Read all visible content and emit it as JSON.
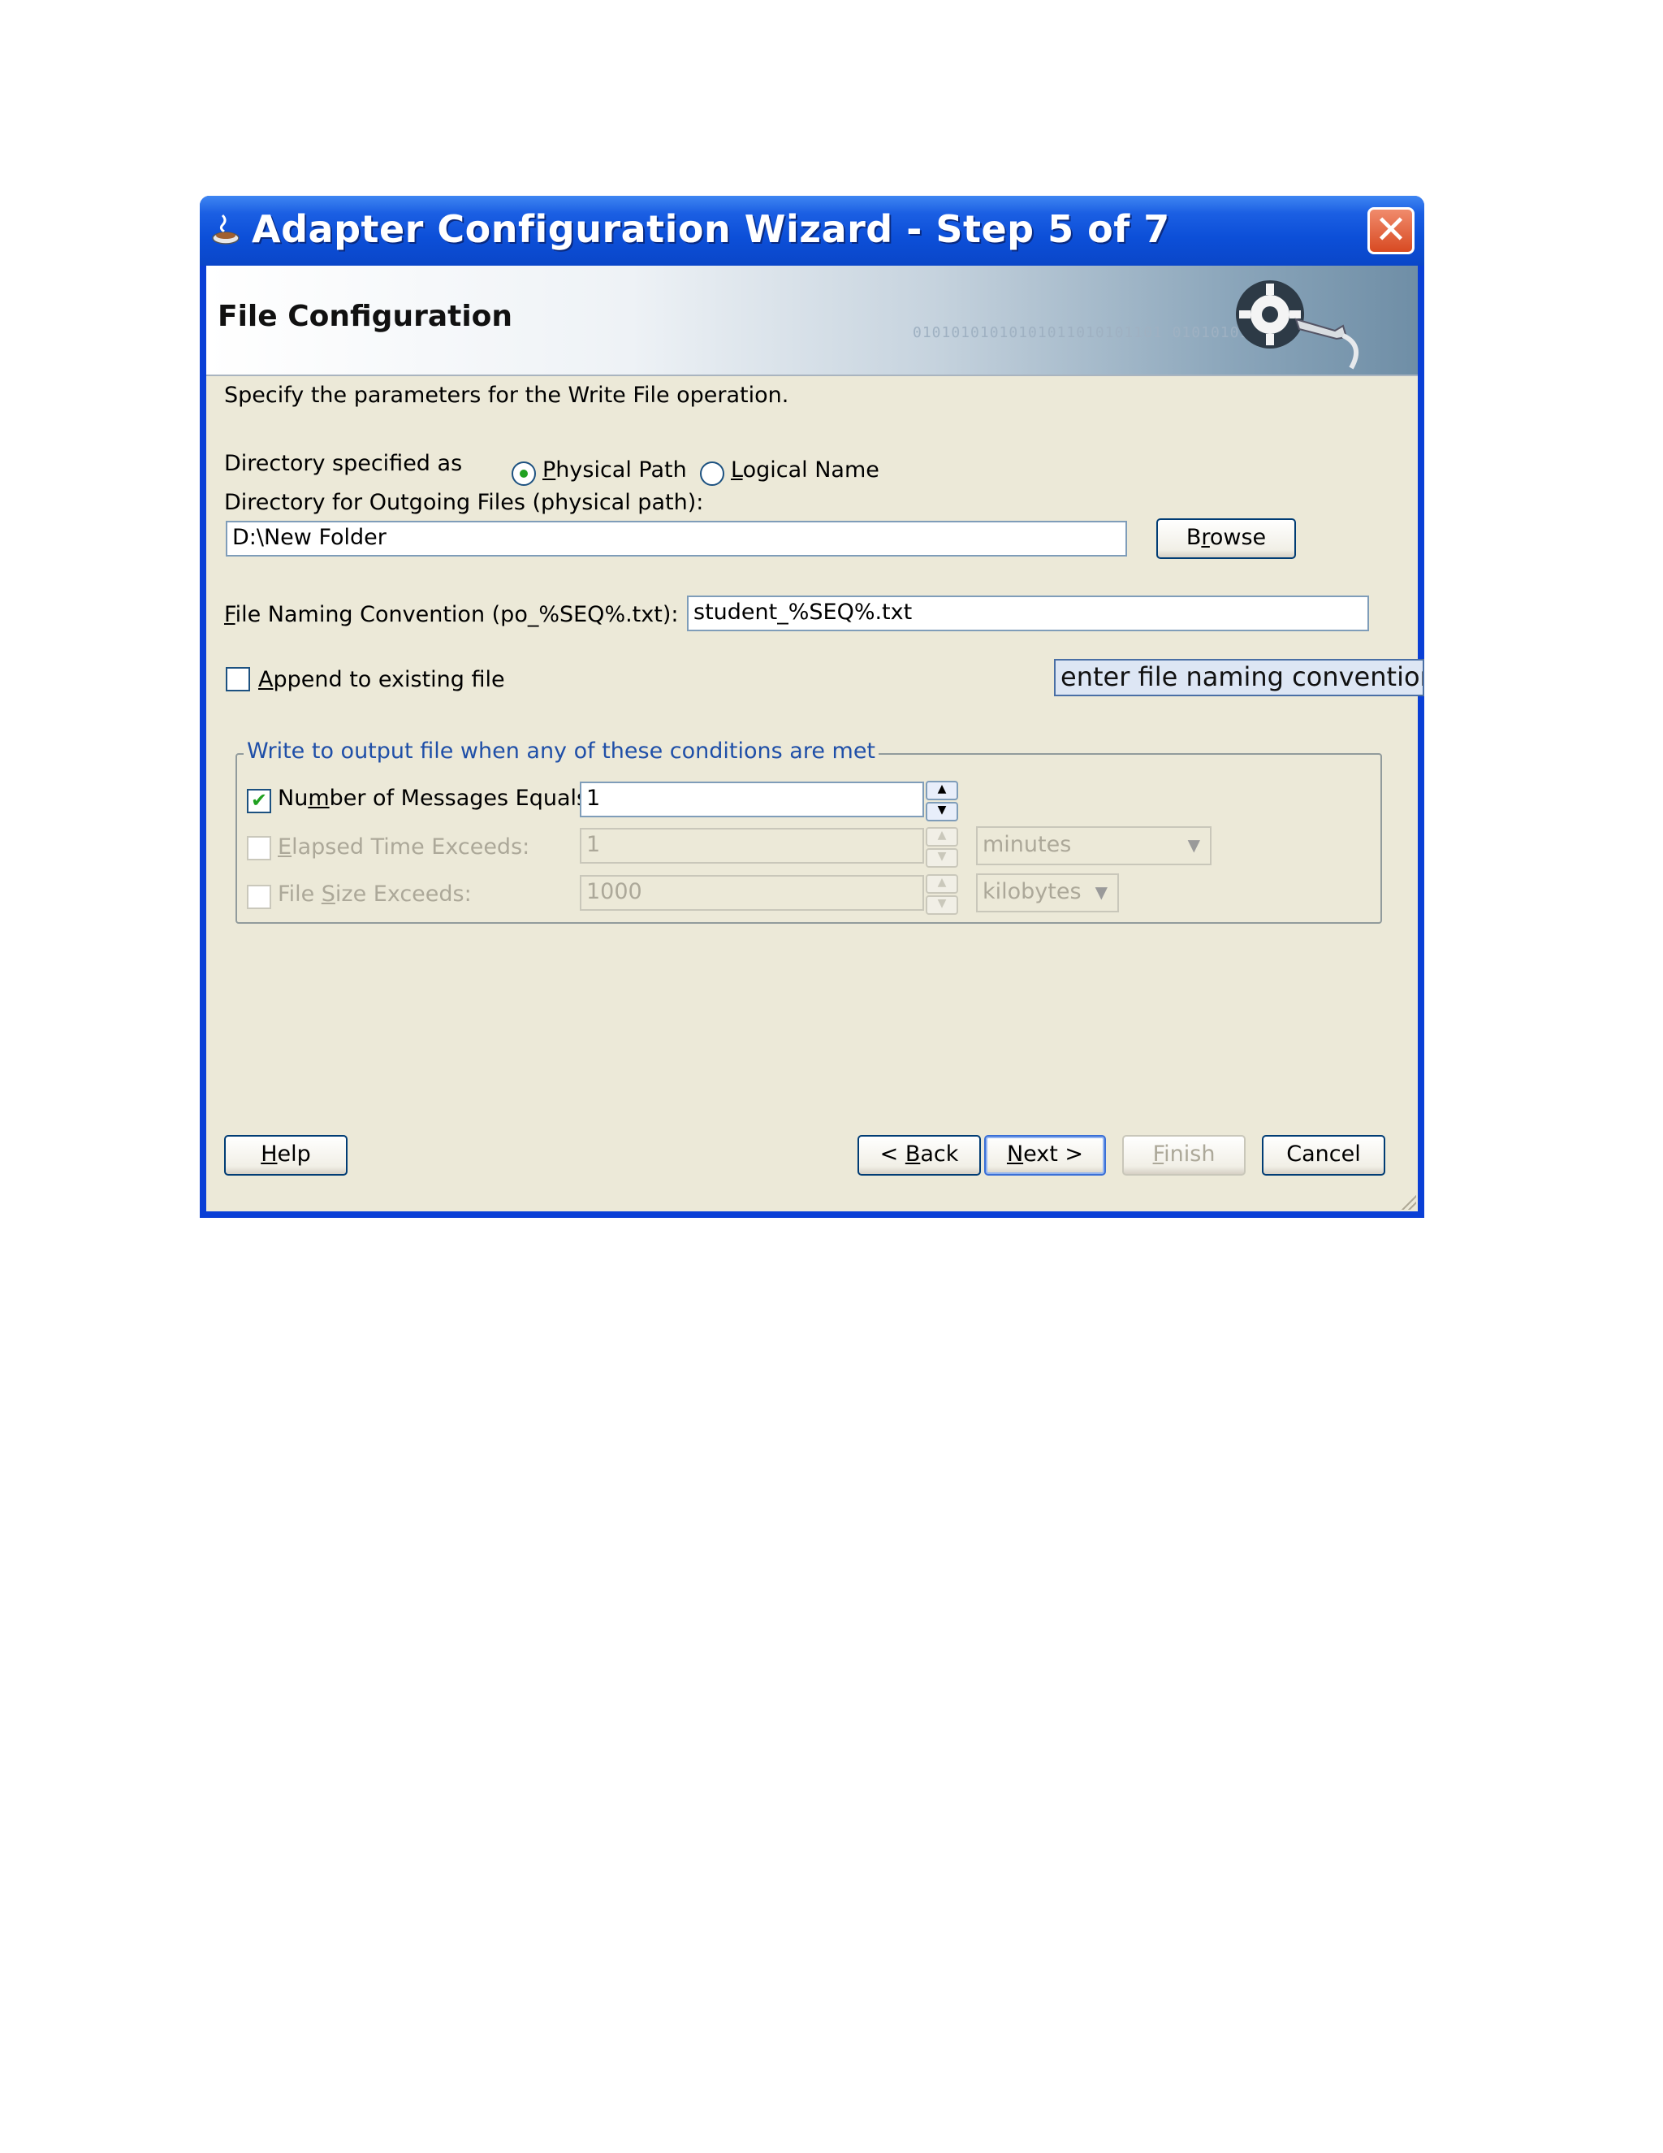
{
  "window": {
    "title": "Adapter Configuration Wizard - Step 5 of 7",
    "close_label": "✕"
  },
  "banner": {
    "title": "File Configuration",
    "binary_text": "01010101010101011010101101 01010101010"
  },
  "form": {
    "instructions": "Specify the parameters for the Write File operation.",
    "directory_specified_as_label": "Directory specified as",
    "radio_physical_prefix": "P",
    "radio_physical_rest": "hysical Path",
    "radio_logical_prefix": "L",
    "radio_logical_rest": "ogical Name",
    "directory_label": "Directory for Outgoing Files (physical path):",
    "directory_value": "D:\\New Folder",
    "browse_prefix": "B",
    "browse_mid": "r",
    "browse_rest": "owse",
    "naming_prefix": "F",
    "naming_rest": "ile Naming Convention (po_%SEQ%.txt):",
    "naming_value": "student_%SEQ%.txt",
    "append_prefix": "A",
    "append_rest": "ppend to existing file",
    "tooltip": "enter file naming convention l"
  },
  "conditions": {
    "group_title": "Write to output file when any of these conditions are met",
    "messages_pre": "Nu",
    "messages_ul": "m",
    "messages_post": "ber of Messages Equals:",
    "messages_value": "1",
    "elapsed_prefix": "E",
    "elapsed_rest": "lapsed Time Exceeds:",
    "elapsed_value": "1",
    "elapsed_unit": "minutes",
    "size_pre": "File ",
    "size_ul": "S",
    "size_post": "ize Exceeds:",
    "size_value": "1000",
    "size_unit": "kilobytes"
  },
  "buttons": {
    "help_prefix": "H",
    "help_rest": "elp",
    "back_pre": "< ",
    "back_ul": "B",
    "back_post": "ack",
    "next_ul": "N",
    "next_post": "ext >",
    "finish_ul": "F",
    "finish_post": "inish",
    "cancel": "Cancel"
  },
  "colors": {
    "title_bar": "#0c4fd8",
    "dialog_bg": "#ece9d8",
    "group_title": "#1f4fa8"
  }
}
